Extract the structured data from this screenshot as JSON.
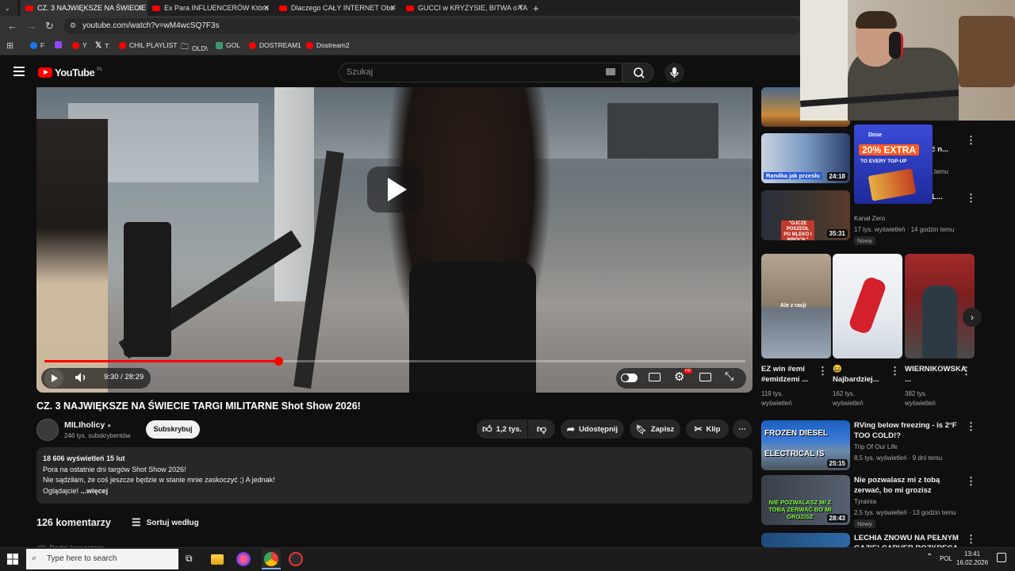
{
  "tabs": [
    {
      "title": "CZ. 3 NAJWIĘKSZE NA ŚWIECIE",
      "active": true
    },
    {
      "title": "Ex Para INFLUENCERÓW Która",
      "active": false
    },
    {
      "title": "Dlaczego CAŁY INTERNET Obs",
      "active": false
    },
    {
      "title": "GUCCI w KRYZYSIE, BITWA o TA",
      "active": false
    }
  ],
  "browser": {
    "url": "youtube.com/watch?v=wM4wcSQ7F3s",
    "bookmarks": [
      {
        "label": "F",
        "icon": "facebook-icon"
      },
      {
        "label": "",
        "icon": "twitch-icon"
      },
      {
        "label": "Y",
        "icon": "youtube-icon"
      },
      {
        "label": "T",
        "icon": "x-icon"
      },
      {
        "label": "CHIL PLAYLIST",
        "icon": "youtube-icon"
      },
      {
        "label": "OLD\\",
        "icon": "folder-icon"
      },
      {
        "label": "GOL",
        "icon": "g-icon"
      },
      {
        "label": "DOSTREAM1",
        "icon": "youtube-icon"
      },
      {
        "label": "Dostream2",
        "icon": "youtube-icon"
      }
    ]
  },
  "youtube": {
    "logo": "YouTube",
    "region": "PL",
    "search_placeholder": "Szukaj"
  },
  "player": {
    "time": "9:30 / 28:29",
    "progress": 0.334
  },
  "video": {
    "title": "CZ. 3 NAJWIĘKSZE NA ŚWIECIE TARGI MILITARNE Shot Show 2026!",
    "channel": "MILIholicy",
    "subscribers": "246 tys. subskrybentów",
    "subscribe_label": "Subskrybuj",
    "likes": "1,2 tys.",
    "share_label": "Udostępnij",
    "save_label": "Zapisz",
    "clip_label": "Klip",
    "description_stats": "18 606 wyświetleń  15 lut",
    "description_lines": [
      "Pora na ostatnie dni targów Shot Show 2026!",
      "Nie sądziłam, że coś jeszcze będzie w stanie mnie zaskoczyć ;) A jednak!",
      "Oglądajcie!"
    ],
    "more_label": "...więcej"
  },
  "comments": {
    "count": "126 komentarzy",
    "sort_label": "Sortuj według",
    "add_placeholder": "Dodaj komentarz..."
  },
  "sidebar": {
    "videos": [
      {
        "title_partial": "...ienić n...",
        "meta": "...tys. ...temu",
        "duration": "24:18",
        "thumb_text": "Randka jak przesłu"
      },
      {
        "title": "...OJ... KO SOBIE, WAL...",
        "channel": "Kanał Zero",
        "meta": "17 tys. wyświetleń · 14 godzin temu",
        "badge": "Nowy",
        "duration": "35:31",
        "thumb_text": "\"OJCZE POSZEDŁ PO MLEKO I WRÓCIŁ\""
      },
      {
        "title": "RVing below freezing - is 2°F TOO COLD!?",
        "channel": "Trip Of Our Life",
        "meta": "8,5 tys. wyświetleń · 9 dni temu",
        "duration": "25:15",
        "thumb_text": "FROZEN DIESEL ELECTRICAL IS"
      },
      {
        "title": "Nie pozwalasz mi z tobą zerwać, bo mi grozisz",
        "channel": "Tyrainia",
        "meta": "2,5 tys. wyświetleń · 13 godzin temu",
        "badge": "Nowy",
        "duration": "28:43",
        "thumb_text": "NIE POZWALASZ MI Z TOBĄ ZERWAĆ BO MI GROZISZ"
      },
      {
        "title": "LECHIA ZNOWU NA PEŁNYM GAZIE! CARVER ROZKRĘCA",
        "channel": "",
        "meta": ""
      }
    ],
    "shorts": [
      {
        "title": "EZ win #emi #emidzemi ...",
        "views": "119 tys. wyświetleń",
        "thumb_text": "Ale z racji"
      },
      {
        "title": "😆 Najbardziej...",
        "views": "162 tys. wyświetleń"
      },
      {
        "title": "WIERNIKOWSKA ...",
        "views": "382 tys. wyświetleń"
      }
    ]
  },
  "ad": {
    "brand": "Dose",
    "headline": "20% EXTRA",
    "subline": "TO EVERY TOP-UP"
  },
  "taskbar": {
    "search_placeholder": "Type here to search",
    "language": "POL",
    "time": "13:41",
    "date": "16.02.2026"
  }
}
